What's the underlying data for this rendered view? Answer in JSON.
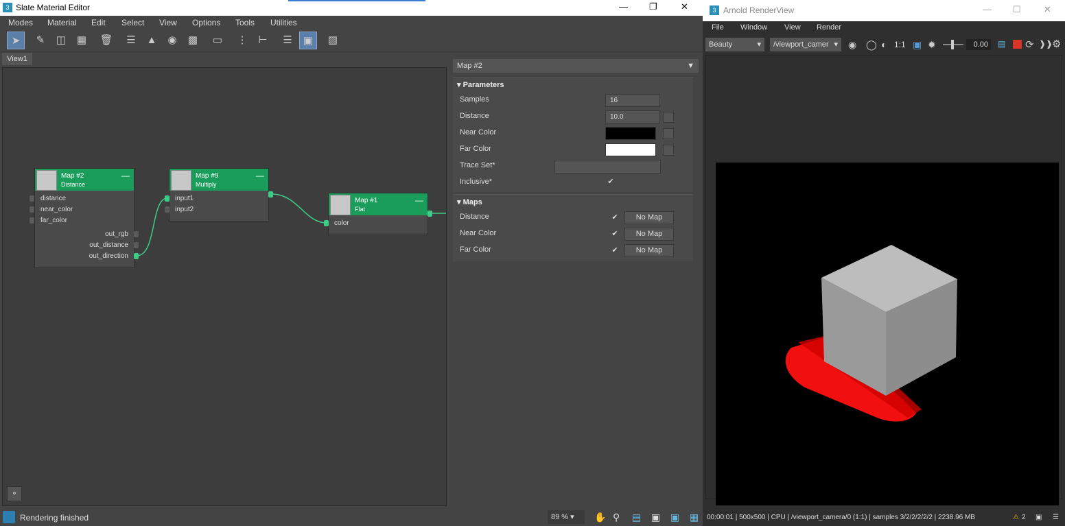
{
  "slate": {
    "title": "Slate Material Editor",
    "app_icon": "3",
    "menu": [
      "Modes",
      "Material",
      "Edit",
      "Select",
      "View",
      "Options",
      "Tools",
      "Utilities"
    ],
    "view_tab": "View1",
    "status": "Rendering finished",
    "zoom": "89 %"
  },
  "nodes": {
    "n2": {
      "name": "Map #2",
      "type": "Distance",
      "inputs": [
        "distance",
        "near_color",
        "far_color"
      ],
      "outputs": [
        "out_rgb",
        "out_distance",
        "out_direction"
      ]
    },
    "n9": {
      "name": "Map #9",
      "type": "Multiply",
      "inputs": [
        "input1",
        "input2"
      ]
    },
    "n1": {
      "name": "Map #1",
      "type": "Flat",
      "inputs": [
        "color"
      ]
    }
  },
  "panel": {
    "dropdown": "Map #2",
    "parameters": {
      "title": "Parameters",
      "samples_label": "Samples",
      "samples_value": "16",
      "distance_label": "Distance",
      "distance_value": "10.0",
      "near_label": "Near Color",
      "far_label": "Far Color",
      "trace_label": "Trace Set*",
      "inclusive_label": "Inclusive*"
    },
    "maps": {
      "title": "Maps",
      "rows": [
        {
          "label": "Distance",
          "button": "No Map"
        },
        {
          "label": "Near Color",
          "button": "No Map"
        },
        {
          "label": "Far Color",
          "button": "No Map"
        }
      ]
    }
  },
  "arnold": {
    "title": "Arnold RenderView",
    "app_icon": "3",
    "menu": [
      "File",
      "Window",
      "View",
      "Render"
    ],
    "aov": "Beauty",
    "camera": "/viewport_camer",
    "ratio": "1:1",
    "exposure": "0.00",
    "status": "00:00:01 | 500x500 | CPU | /viewport_camera/0 (1:1) | samples 3/2/2/2/2/2 | 2238.96 MB",
    "warnings": "2"
  },
  "colors": {
    "node_header": "#1a9c5a",
    "wire": "#3dcc88",
    "stop": "#d9342b"
  }
}
